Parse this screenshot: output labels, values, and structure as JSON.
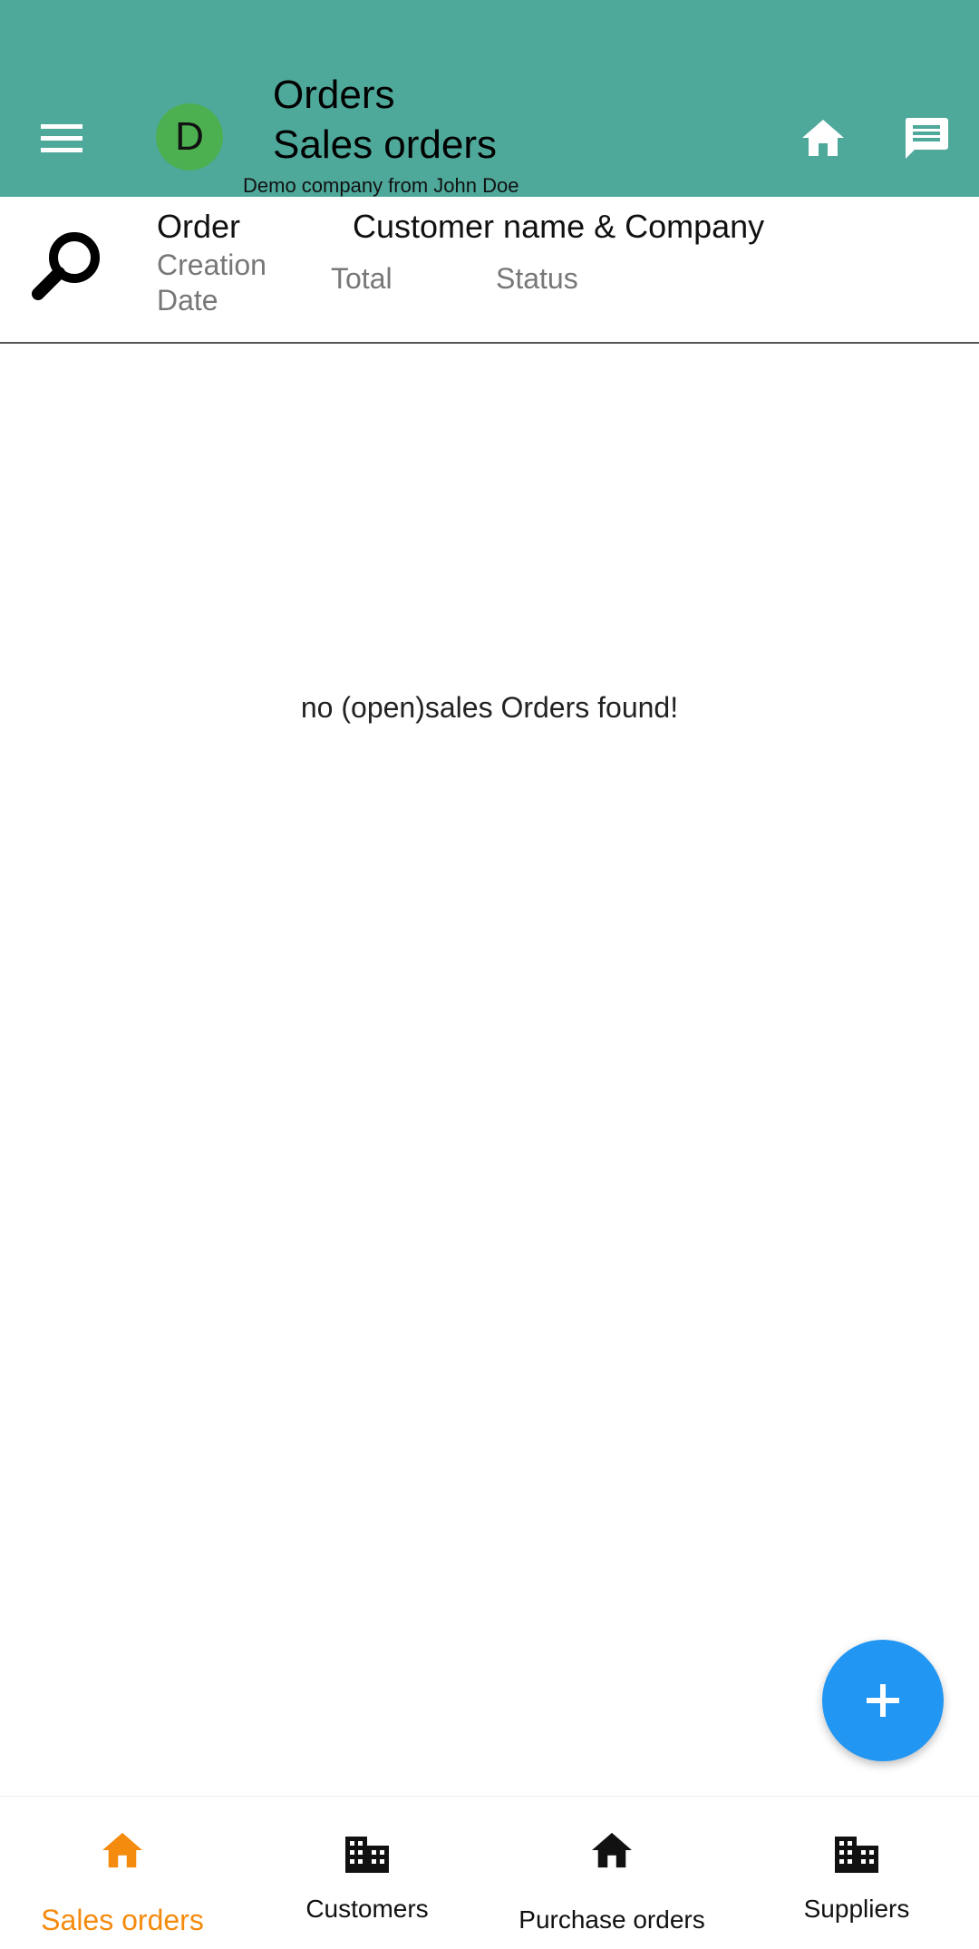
{
  "app_bar": {
    "avatar_letter": "D",
    "title": "Orders",
    "subtitle_title": "Sales orders",
    "company": "Demo company from John Doe",
    "icons": [
      "menu-icon",
      "home-icon",
      "chat-icon"
    ],
    "background": "#4fa99b"
  },
  "list_header": {
    "order": "Order",
    "customer": "Customer name & Company",
    "creation_date": "Creation Date",
    "total": "Total",
    "status": "Status"
  },
  "main": {
    "empty_message": "no (open)sales Orders found!"
  },
  "fab": {
    "icon": "add-icon",
    "color": "#2196f3"
  },
  "bottom_nav": {
    "items": [
      {
        "label": "Sales orders",
        "icon": "home-icon",
        "active": true
      },
      {
        "label": "Customers",
        "icon": "building-icon",
        "active": false
      },
      {
        "label": "Purchase orders",
        "icon": "home-icon",
        "active": false
      },
      {
        "label": "Suppliers",
        "icon": "building-icon",
        "active": false
      }
    ],
    "active_color": "#f58b0e"
  }
}
